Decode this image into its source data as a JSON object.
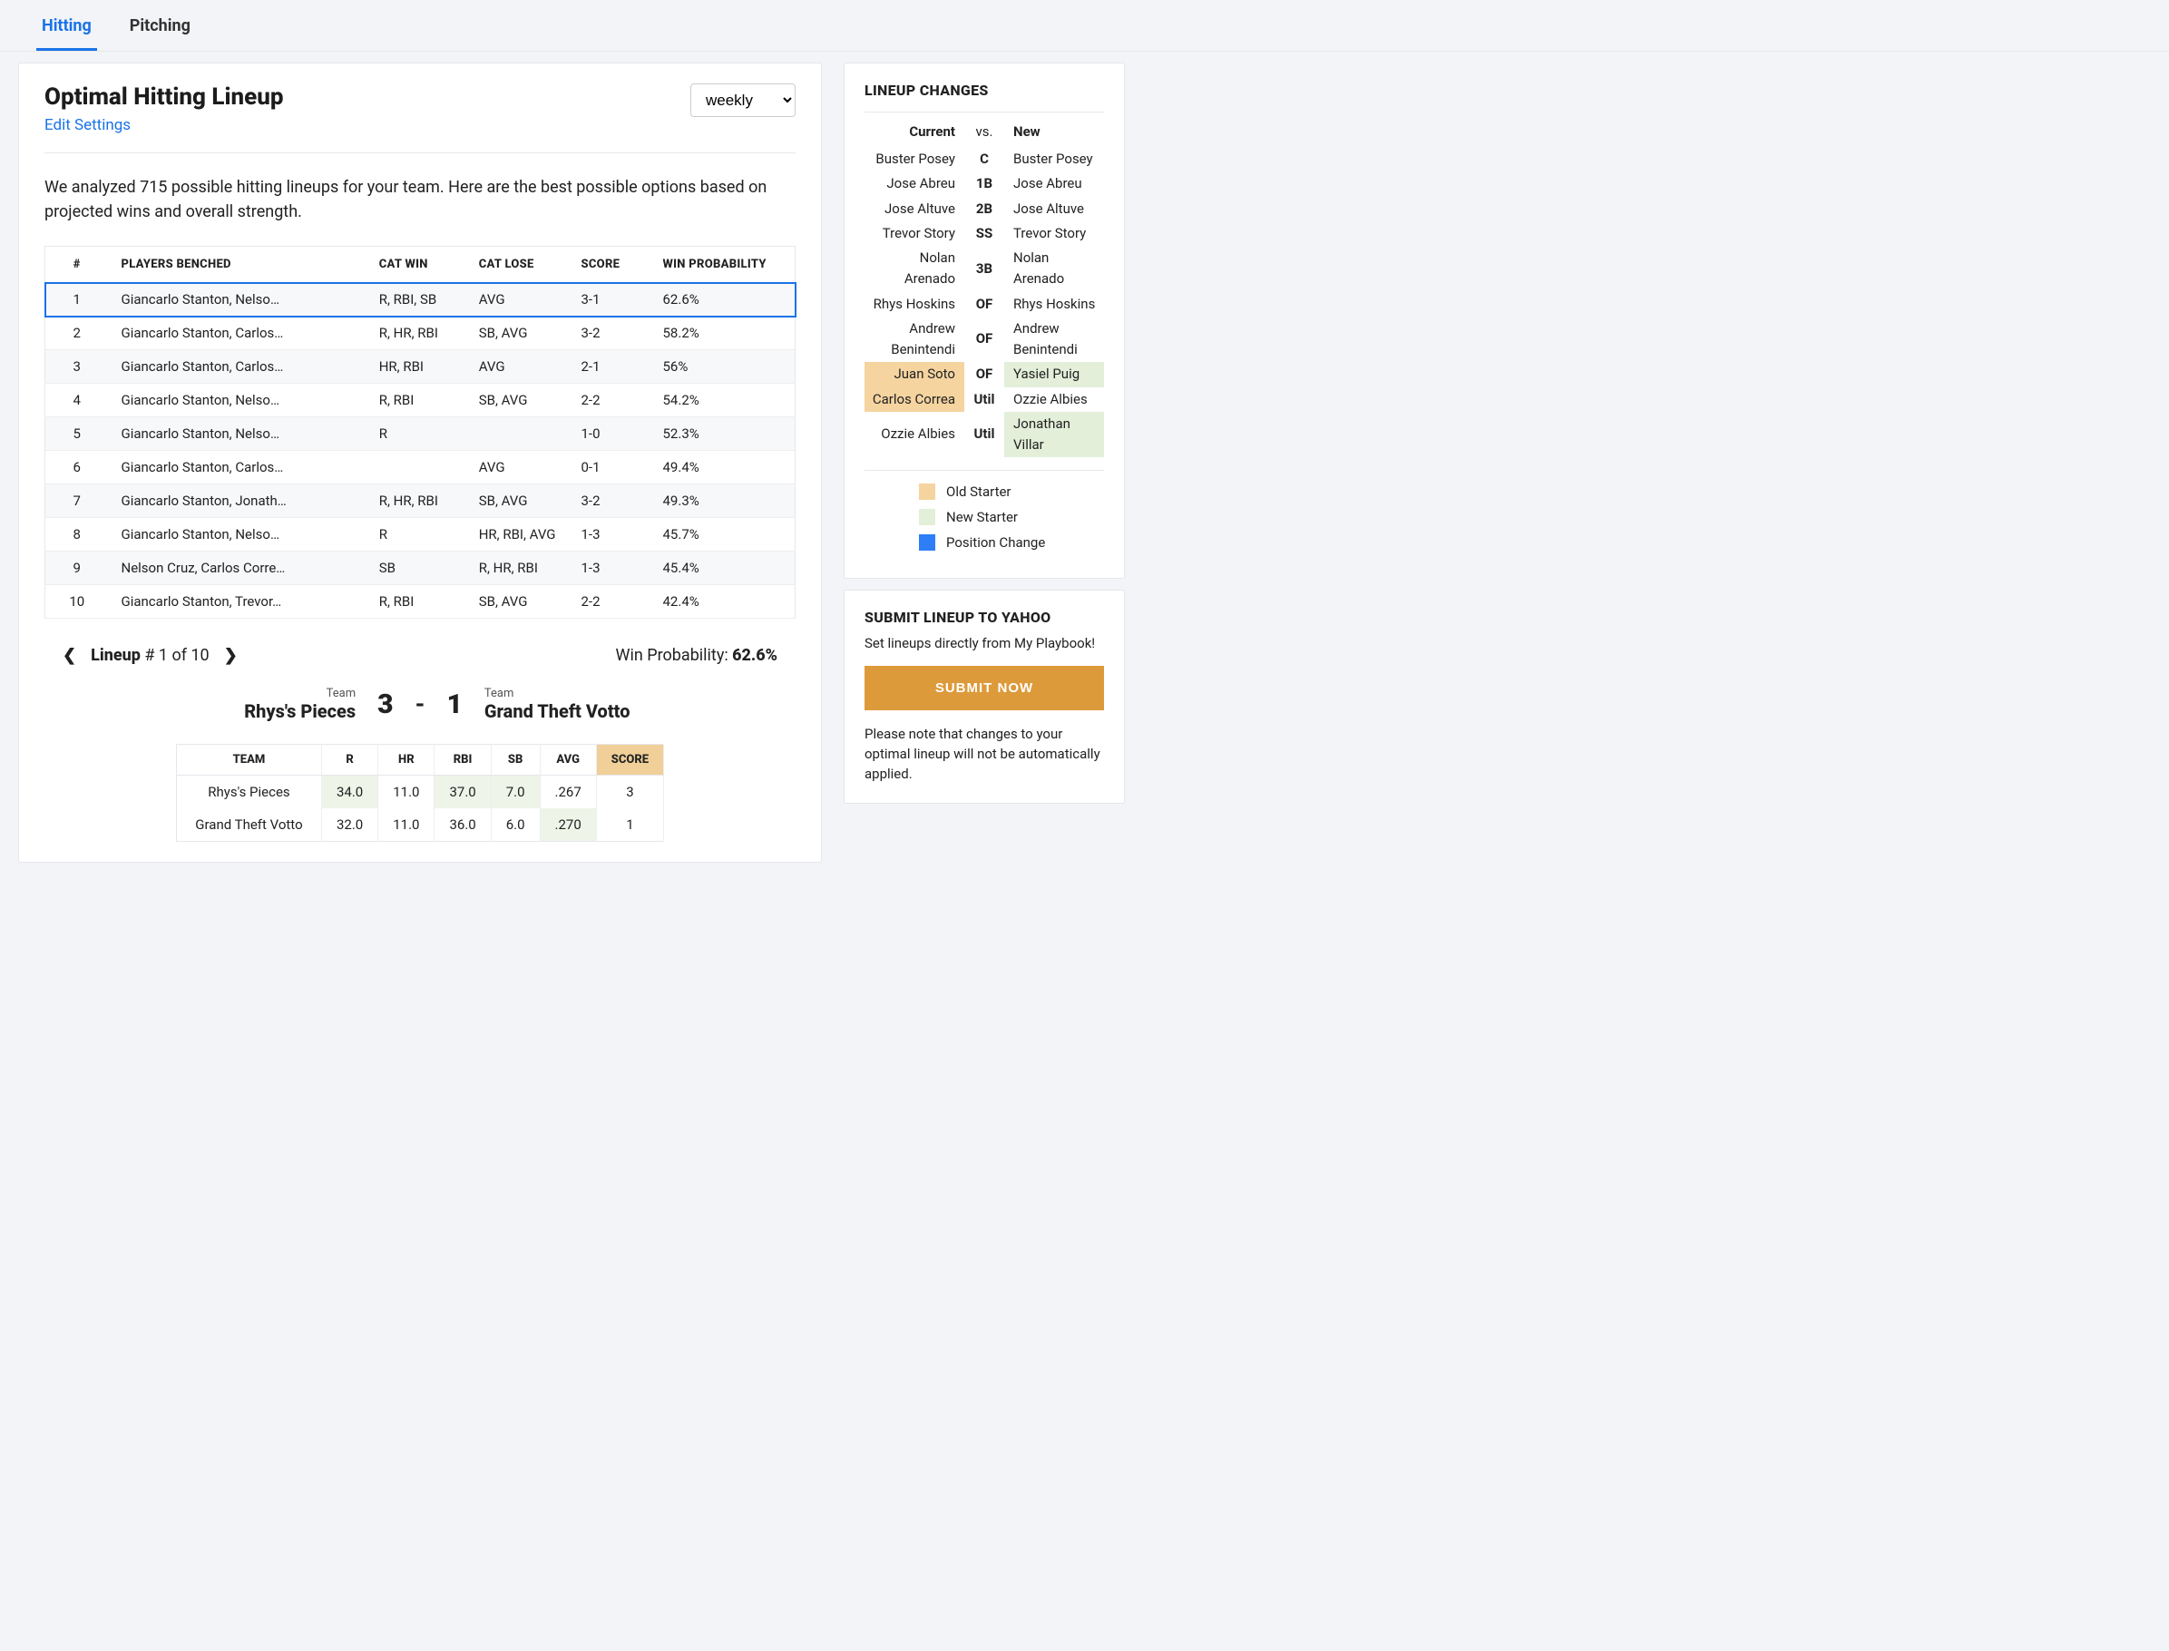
{
  "tabs": {
    "hitting": "Hitting",
    "pitching": "Pitching"
  },
  "header": {
    "title": "Optimal Hitting Lineup",
    "edit": "Edit Settings",
    "period_selected": "weekly"
  },
  "intro": "We analyzed 715 possible hitting lineups for your team. Here are the best possible options based on projected wins and overall strength.",
  "table": {
    "cols": {
      "num": "#",
      "players": "PLAYERS BENCHED",
      "catwin": "CAT WIN",
      "catlose": "CAT LOSE",
      "score": "SCORE",
      "winp": "WIN PROBABILITY"
    },
    "rows": [
      {
        "num": "1",
        "players": "Giancarlo Stanton, Nelso…",
        "catwin": "R, RBI, SB",
        "catlose": "AVG",
        "score": "3-1",
        "winp": "62.6%"
      },
      {
        "num": "2",
        "players": "Giancarlo Stanton, Carlos…",
        "catwin": "R, HR, RBI",
        "catlose": "SB, AVG",
        "score": "3-2",
        "winp": "58.2%"
      },
      {
        "num": "3",
        "players": "Giancarlo Stanton, Carlos…",
        "catwin": "HR, RBI",
        "catlose": "AVG",
        "score": "2-1",
        "winp": "56%"
      },
      {
        "num": "4",
        "players": "Giancarlo Stanton, Nelso…",
        "catwin": "R, RBI",
        "catlose": "SB, AVG",
        "score": "2-2",
        "winp": "54.2%"
      },
      {
        "num": "5",
        "players": "Giancarlo Stanton, Nelso…",
        "catwin": "R",
        "catlose": "",
        "score": "1-0",
        "winp": "52.3%"
      },
      {
        "num": "6",
        "players": "Giancarlo Stanton, Carlos…",
        "catwin": "",
        "catlose": "AVG",
        "score": "0-1",
        "winp": "49.4%"
      },
      {
        "num": "7",
        "players": "Giancarlo Stanton, Jonath…",
        "catwin": "R, HR, RBI",
        "catlose": "SB, AVG",
        "score": "3-2",
        "winp": "49.3%"
      },
      {
        "num": "8",
        "players": "Giancarlo Stanton, Nelso…",
        "catwin": "R",
        "catlose": "HR, RBI, AVG",
        "score": "1-3",
        "winp": "45.7%"
      },
      {
        "num": "9",
        "players": "Nelson Cruz, Carlos Corre…",
        "catwin": "SB",
        "catlose": "R, HR, RBI",
        "score": "1-3",
        "winp": "45.4%"
      },
      {
        "num": "10",
        "players": "Giancarlo Stanton, Trevor…",
        "catwin": "R, RBI",
        "catlose": "SB, AVG",
        "score": "2-2",
        "winp": "42.4%"
      }
    ]
  },
  "nav": {
    "label": "Lineup",
    "position": "# 1 of 10",
    "winprob_label": "Win Probability: ",
    "winprob_value": "62.6%"
  },
  "matchup": {
    "team_label": "Team",
    "team_a": "Rhys's Pieces",
    "score_a": "3",
    "dash": "-",
    "score_b": "1",
    "team_b": "Grand Theft Votto"
  },
  "statgrid": {
    "cols": [
      "TEAM",
      "R",
      "HR",
      "RBI",
      "SB",
      "AVG",
      "SCORE"
    ],
    "rows": [
      {
        "team": "Rhys's Pieces",
        "cells": [
          "34.0",
          "11.0",
          "37.0",
          "7.0",
          ".267",
          "3"
        ],
        "wins": [
          true,
          false,
          true,
          true,
          false,
          false
        ]
      },
      {
        "team": "Grand Theft Votto",
        "cells": [
          "32.0",
          "11.0",
          "36.0",
          "6.0",
          ".270",
          "1"
        ],
        "wins": [
          false,
          false,
          false,
          false,
          true,
          false
        ]
      }
    ]
  },
  "changes": {
    "title": "LINEUP CHANGES",
    "head": {
      "current": "Current",
      "vs": "vs.",
      "new": "New"
    },
    "rows": [
      {
        "current": "Buster Posey",
        "pos": "C",
        "new": "Buster Posey",
        "oc": "",
        "nc": ""
      },
      {
        "current": "Jose Abreu",
        "pos": "1B",
        "new": "Jose Abreu",
        "oc": "",
        "nc": ""
      },
      {
        "current": "Jose Altuve",
        "pos": "2B",
        "new": "Jose Altuve",
        "oc": "",
        "nc": ""
      },
      {
        "current": "Trevor Story",
        "pos": "SS",
        "new": "Trevor Story",
        "oc": "",
        "nc": ""
      },
      {
        "current": "Nolan Arenado",
        "pos": "3B",
        "new": "Nolan Arenado",
        "oc": "",
        "nc": ""
      },
      {
        "current": "Rhys Hoskins",
        "pos": "OF",
        "new": "Rhys Hoskins",
        "oc": "",
        "nc": ""
      },
      {
        "current": "Andrew Benintendi",
        "pos": "OF",
        "new": "Andrew Benintendi",
        "oc": "",
        "nc": ""
      },
      {
        "current": "Juan Soto",
        "pos": "OF",
        "new": "Yasiel Puig",
        "oc": "old-starter",
        "nc": "new-starter"
      },
      {
        "current": "Carlos Correa",
        "pos": "Util",
        "new": "Ozzie Albies",
        "oc": "old-starter",
        "nc": ""
      },
      {
        "current": "Ozzie Albies",
        "pos": "Util",
        "new": "Jonathan Villar",
        "oc": "",
        "nc": "new-starter"
      }
    ],
    "legend": {
      "old": "Old Starter",
      "new": "New Starter",
      "pos": "Position Change"
    }
  },
  "submit": {
    "title": "SUBMIT LINEUP TO YAHOO",
    "desc": "Set lineups directly from My Playbook!",
    "button": "SUBMIT NOW",
    "note": "Please note that changes to your optimal lineup will not be automatically applied."
  }
}
